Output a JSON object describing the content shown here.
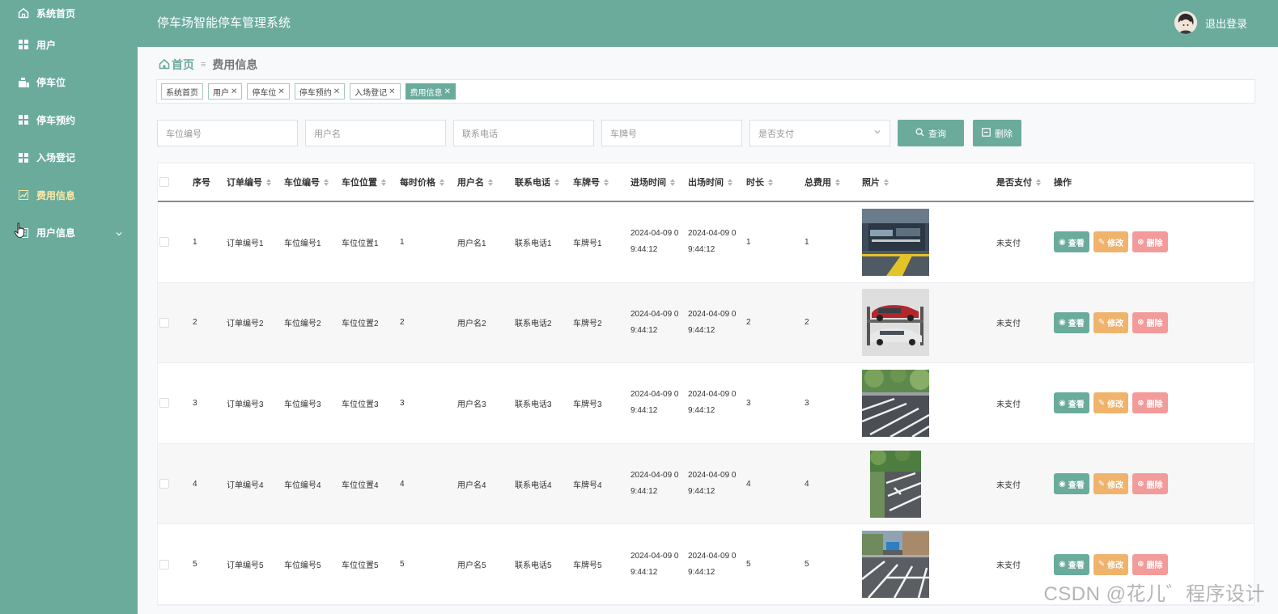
{
  "app": {
    "title": "停车场智能停车管理系统",
    "logout_label": "退出登录"
  },
  "sidebar": {
    "items": [
      {
        "label": "系统首页",
        "icon": "home-icon"
      },
      {
        "label": "用户",
        "icon": "grid-icon"
      },
      {
        "label": "停车位",
        "icon": "parking-icon"
      },
      {
        "label": "停车预约",
        "icon": "grid-icon"
      },
      {
        "label": "入场登记",
        "icon": "grid-icon"
      },
      {
        "label": "费用信息",
        "icon": "chart-icon",
        "active": true
      },
      {
        "label": "用户信息",
        "icon": "doc-icon",
        "expandable": true
      }
    ]
  },
  "breadcrumb": {
    "home": "首页",
    "separator": "≡",
    "current": "费用信息"
  },
  "tags": [
    {
      "label": "系统首页",
      "closable": false
    },
    {
      "label": "用户",
      "closable": true
    },
    {
      "label": "停车位",
      "closable": true
    },
    {
      "label": "停车预约",
      "closable": true
    },
    {
      "label": "入场登记",
      "closable": true
    },
    {
      "label": "费用信息",
      "closable": true,
      "active": true
    }
  ],
  "search": {
    "space_no_placeholder": "车位编号",
    "username_placeholder": "用户名",
    "phone_placeholder": "联系电话",
    "plate_placeholder": "车牌号",
    "paid_placeholder": "是否支付",
    "query_label": "查询",
    "delete_label": "删除"
  },
  "table": {
    "headers": {
      "index": "序号",
      "order_no": "订单编号",
      "space_no": "车位编号",
      "space_loc": "车位位置",
      "price": "每时价格",
      "username": "用户名",
      "phone": "联系电话",
      "plate": "车牌号",
      "in_time": "进场时间",
      "out_time": "出场时间",
      "duration": "时长",
      "total": "总费用",
      "photo": "照片",
      "paid": "是否支付",
      "actions": "操作"
    },
    "rows": [
      {
        "index": "1",
        "order_no": "订单编号1",
        "space_no": "车位编号1",
        "space_loc": "车位位置1",
        "price": "1",
        "username": "用户名1",
        "phone": "联系电话1",
        "plate": "车牌号1",
        "in_time_1": "2024-04-09 0",
        "in_time_2": "9:44:12",
        "out_time_1": "2024-04-09 0",
        "out_time_2": "9:44:12",
        "duration": "1",
        "total": "1",
        "paid": "未支付",
        "photo_theme": "garage"
      },
      {
        "index": "2",
        "order_no": "订单编号2",
        "space_no": "车位编号2",
        "space_loc": "车位位置2",
        "price": "2",
        "username": "用户名2",
        "phone": "联系电话2",
        "plate": "车牌号2",
        "in_time_1": "2024-04-09 0",
        "in_time_2": "9:44:12",
        "out_time_1": "2024-04-09 0",
        "out_time_2": "9:44:12",
        "duration": "2",
        "total": "2",
        "paid": "未支付",
        "photo_theme": "lift"
      },
      {
        "index": "3",
        "order_no": "订单编号3",
        "space_no": "车位编号3",
        "space_loc": "车位位置3",
        "price": "3",
        "username": "用户名3",
        "phone": "联系电话3",
        "plate": "车牌号3",
        "in_time_1": "2024-04-09 0",
        "in_time_2": "9:44:12",
        "out_time_1": "2024-04-09 0",
        "out_time_2": "9:44:12",
        "duration": "3",
        "total": "3",
        "paid": "未支付",
        "photo_theme": "lot"
      },
      {
        "index": "4",
        "order_no": "订单编号4",
        "space_no": "车位编号4",
        "space_loc": "车位位置4",
        "price": "4",
        "username": "用户名4",
        "phone": "联系电话4",
        "plate": "车牌号4",
        "in_time_1": "2024-04-09 0",
        "in_time_2": "9:44:12",
        "out_time_1": "2024-04-09 0",
        "out_time_2": "9:44:12",
        "duration": "4",
        "total": "4",
        "paid": "未支付",
        "photo_theme": "road"
      },
      {
        "index": "5",
        "order_no": "订单编号5",
        "space_no": "车位编号5",
        "space_loc": "车位位置5",
        "price": "5",
        "username": "用户名5",
        "phone": "联系电话5",
        "plate": "车牌号5",
        "in_time_1": "2024-04-09 0",
        "in_time_2": "9:44:12",
        "out_time_1": "2024-04-09 0",
        "out_time_2": "9:44:12",
        "duration": "5",
        "total": "5",
        "paid": "未支付",
        "photo_theme": "street"
      }
    ],
    "action_labels": {
      "view": "查看",
      "edit": "修改",
      "delete": "删除"
    }
  },
  "watermark": "CSDN @花儿゛程序设计",
  "colors": {
    "primary": "#6aab9c",
    "edit": "#f0b36c",
    "delete": "#f39a9a",
    "active_menu_text": "#fbe9a6"
  }
}
